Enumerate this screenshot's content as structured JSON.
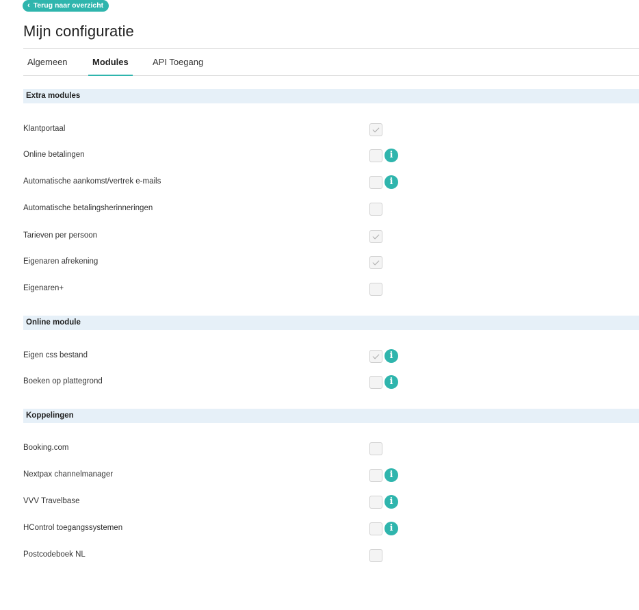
{
  "back_button": {
    "label": "Terug naar overzicht",
    "icon": "chevron-left-icon"
  },
  "page_title": "Mijn configuratie",
  "tabs": [
    {
      "label": "Algemeen",
      "active": false
    },
    {
      "label": "Modules",
      "active": true
    },
    {
      "label": "API Toegang",
      "active": false
    }
  ],
  "sections": [
    {
      "title": "Extra modules",
      "items": [
        {
          "label": "Klantportaal",
          "checked": true,
          "info": false
        },
        {
          "label": "Online betalingen",
          "checked": false,
          "info": true
        },
        {
          "label": "Automatische aankomst/vertrek e-mails",
          "checked": false,
          "info": true
        },
        {
          "label": "Automatische betalingsherinneringen",
          "checked": false,
          "info": false
        },
        {
          "label": "Tarieven per persoon",
          "checked": true,
          "info": false
        },
        {
          "label": "Eigenaren afrekening",
          "checked": true,
          "info": false
        },
        {
          "label": "Eigenaren+",
          "checked": false,
          "info": false
        }
      ]
    },
    {
      "title": "Online module",
      "items": [
        {
          "label": "Eigen css bestand",
          "checked": true,
          "info": true
        },
        {
          "label": "Boeken op plattegrond",
          "checked": false,
          "info": true
        }
      ]
    },
    {
      "title": "Koppelingen",
      "items": [
        {
          "label": "Booking.com",
          "checked": false,
          "info": false
        },
        {
          "label": "Nextpax channelmanager",
          "checked": false,
          "info": true
        },
        {
          "label": "VVV Travelbase",
          "checked": false,
          "info": true
        },
        {
          "label": "HControl toegangssystemen",
          "checked": false,
          "info": true
        },
        {
          "label": "Postcodeboek NL",
          "checked": false,
          "info": false
        }
      ]
    }
  ],
  "info_glyph": "i",
  "colors": {
    "accent": "#2fb5ad",
    "section_bg": "#e6f0f8"
  }
}
